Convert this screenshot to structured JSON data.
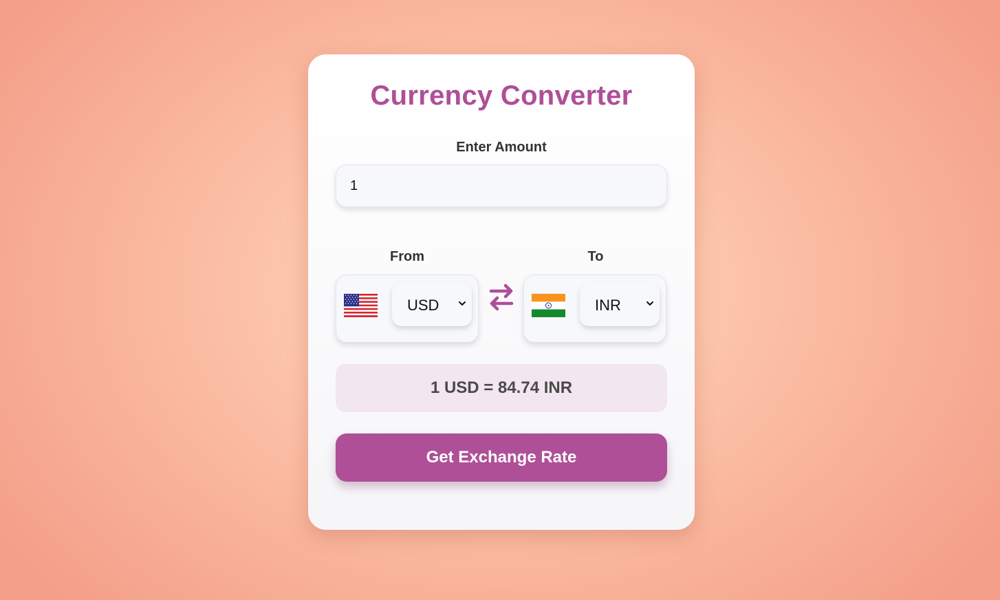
{
  "title": "Currency Converter",
  "amount": {
    "label": "Enter Amount",
    "value": "1"
  },
  "from": {
    "label": "From",
    "currency": "USD",
    "flag_icon": "us-flag-icon"
  },
  "to": {
    "label": "To",
    "currency": "INR",
    "flag_icon": "india-flag-icon"
  },
  "swap_icon": "swap-arrows-icon",
  "result_text": "1 USD = 84.74 INR",
  "button_label": "Get Exchange Rate",
  "colors": {
    "accent": "#ae4f98",
    "result_background": "#f2e6f0",
    "page_background": "#fcc6ab"
  }
}
